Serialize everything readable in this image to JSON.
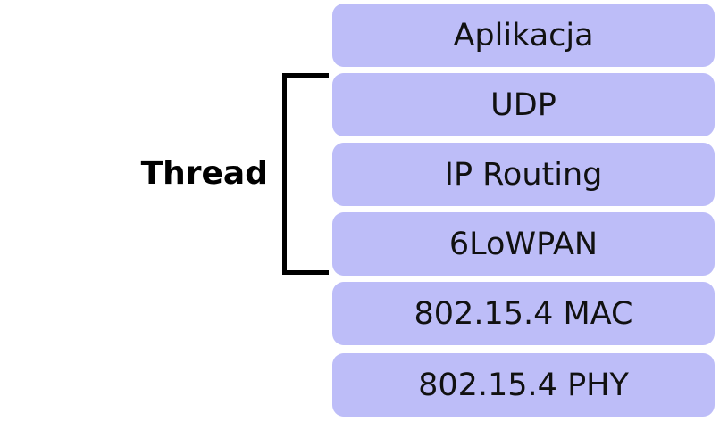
{
  "diagram": {
    "group_label": "Thread",
    "layers": [
      "Aplikacja",
      "UDP",
      "IP Routing",
      "6LoWPAN",
      "802.15.4 MAC",
      "802.15.4 PHY"
    ],
    "colors": {
      "layer_fill": "#bdbdf8",
      "bracket": "#000000"
    }
  }
}
